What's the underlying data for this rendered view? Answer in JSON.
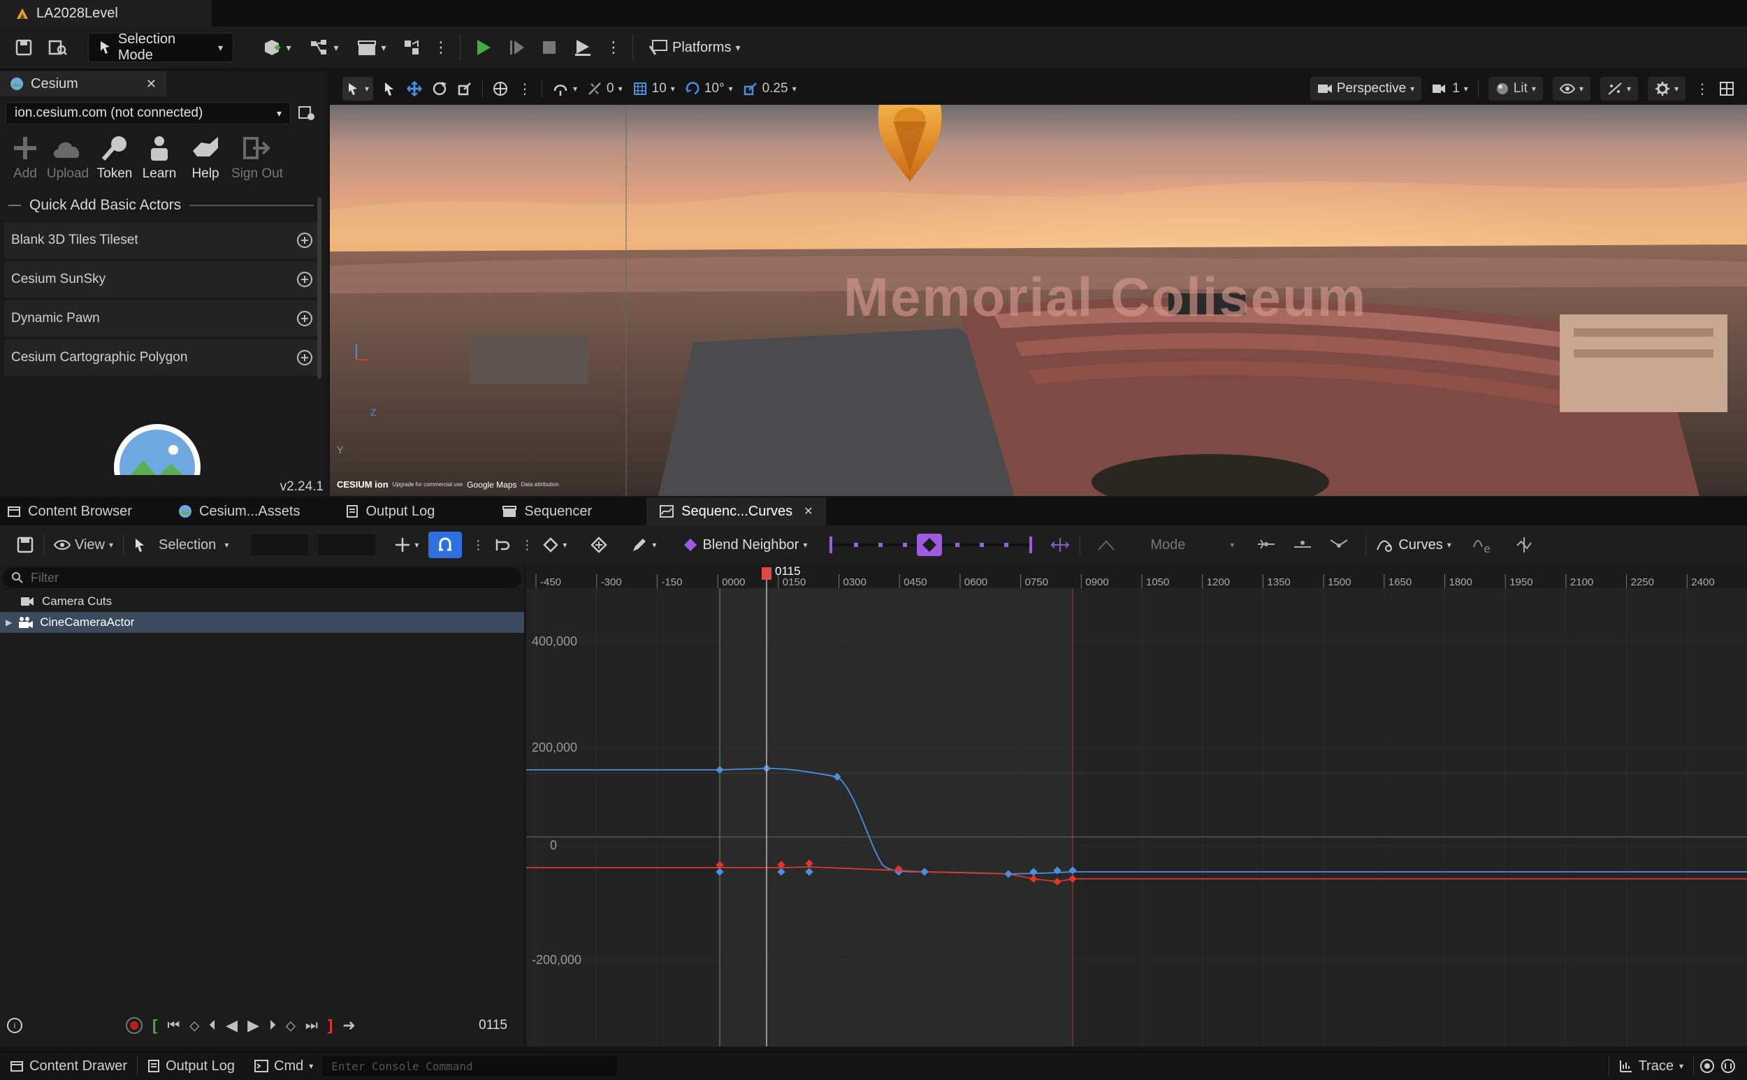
{
  "window": {
    "title": "LA2028Level"
  },
  "toolbar": {
    "selection_mode": "Selection Mode",
    "platforms": "Platforms"
  },
  "cesium": {
    "tab_label": "Cesium",
    "server": "ion.cesium.com (not connected)",
    "actions": [
      "Add",
      "Upload",
      "Token",
      "Learn",
      "Help",
      "Sign Out"
    ],
    "section_title": "Quick Add Basic Actors",
    "items": [
      "Blank 3D Tiles Tileset",
      "Cesium SunSky",
      "Dynamic Pawn",
      "Cesium Cartographic Polygon"
    ],
    "version": "v2.24.1"
  },
  "viewport": {
    "snap_translate": "0",
    "grid_size": "10",
    "rotation_snap": "10°",
    "scale_snap": "0.25",
    "perspective": "Perspective",
    "camera_speed": "1",
    "lit": "Lit",
    "scene_label": "Memorial Coliseum",
    "watermark": "CESIUM ion",
    "watermark_note": "Upgrade for commercial use",
    "google_maps": "Google Maps",
    "data_attribution": "Data attribution",
    "axis_z": "Z",
    "axis_y": "Y"
  },
  "bottom_tabs": [
    "Content Browser",
    "Cesium...Assets",
    "Output Log",
    "Sequencer",
    "Sequenc...Curves"
  ],
  "sequencer": {
    "view": "View",
    "selection": "Selection",
    "blend": "Blend Neighbor",
    "mode": "Mode",
    "curves": "Curves",
    "filter_placeholder": "Filter",
    "tracks": [
      "Camera Cuts",
      "CineCameraActor"
    ],
    "current_frame": "0115",
    "playhead_label": "0115",
    "ruler_ticks": [
      "-450",
      "-300",
      "-150",
      "0000",
      "0150",
      "0300",
      "0450",
      "0600",
      "0750",
      "0900",
      "1050",
      "1200",
      "1350",
      "1500",
      "1650",
      "1800",
      "1950",
      "2100",
      "2250",
      "2400"
    ],
    "y_labels": [
      "400,000",
      "200,000",
      "0",
      "-200,000"
    ]
  },
  "statusbar": {
    "content_drawer": "Content Drawer",
    "output_log": "Output Log",
    "cmd": "Cmd",
    "console_placeholder": "Enter Console Command",
    "trace": "Trace"
  },
  "colors": {
    "accent_blue": "#2f6fe0",
    "play_green": "#3fb040",
    "key_blue": "#4a90e2",
    "key_red": "#e0362c",
    "playhead": "#e04848",
    "blend_purple": "#a05ce0"
  }
}
